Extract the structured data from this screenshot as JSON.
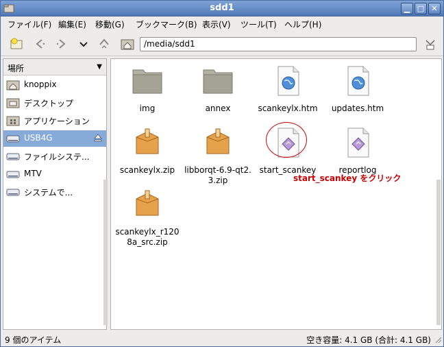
{
  "window": {
    "title": "sdd1"
  },
  "menubar": {
    "items": [
      {
        "label": "ファイル(F)"
      },
      {
        "label": "編集(E)"
      },
      {
        "label": "移動(G)"
      },
      {
        "label": "ブックマーク(B)"
      },
      {
        "label": "表示(V)"
      },
      {
        "label": "ツール(T)"
      },
      {
        "label": "ヘルプ(H)"
      }
    ]
  },
  "toolbar": {
    "path": "/media/sdd1"
  },
  "sidebar": {
    "header": "場所",
    "items": [
      {
        "label": "knoppix",
        "icon": "home-folder-icon"
      },
      {
        "label": "デスクトップ",
        "icon": "desktop-folder-icon"
      },
      {
        "label": "アプリケーション",
        "icon": "applications-folder-icon"
      },
      {
        "label": "USB4G",
        "icon": "usb-drive-icon",
        "selected": true
      },
      {
        "label": "ファイルシステ...",
        "icon": "drive-icon"
      },
      {
        "label": "MTV",
        "icon": "drive-icon"
      },
      {
        "label": "システムで...",
        "icon": "drive-icon"
      }
    ]
  },
  "files": [
    {
      "name": "img",
      "type": "folder"
    },
    {
      "name": "annex",
      "type": "folder"
    },
    {
      "name": "scankeylx.htm",
      "type": "html"
    },
    {
      "name": "updates.htm",
      "type": "html"
    },
    {
      "name": "scankeylx.zip",
      "type": "zip"
    },
    {
      "name": "libborqt-6.9-qt2.3.zip",
      "type": "zip"
    },
    {
      "name": "start_scankey",
      "type": "exec"
    },
    {
      "name": "reportlog",
      "type": "exec"
    },
    {
      "name": "scankeylx_r1208a_src.zip",
      "type": "zip"
    }
  ],
  "annotation": {
    "text": "start_scankey をクリック",
    "color": "#cc0000"
  },
  "statusbar": {
    "left": "9 個のアイテム",
    "right": "空き容量: 4.1 GB (合計: 4.1 GB)"
  },
  "colors": {
    "titlebar": "#5f86c2",
    "selection": "#86abd9",
    "annotation": "#cc0000"
  }
}
